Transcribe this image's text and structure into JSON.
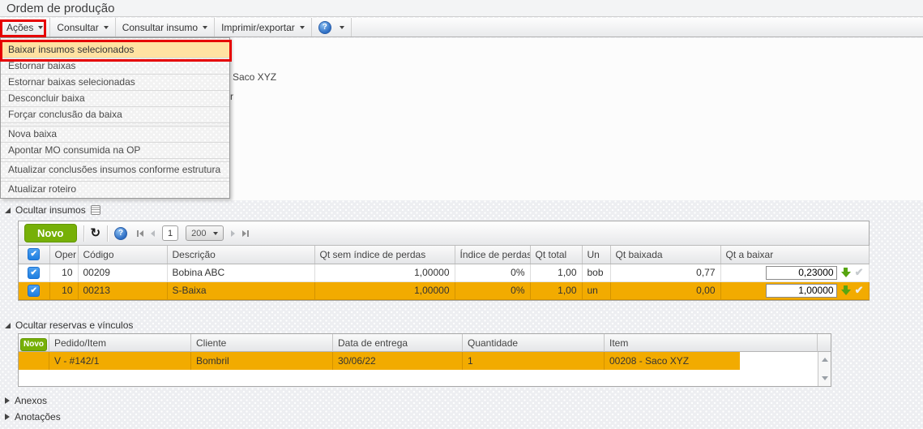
{
  "page": {
    "title": "Ordem de produção"
  },
  "toolbar": {
    "menus": [
      {
        "label": "Ações"
      },
      {
        "label": "Consultar"
      },
      {
        "label": "Consultar insumo"
      },
      {
        "label": "Imprimir/exportar"
      }
    ]
  },
  "icons": {
    "help": "?",
    "refresh": "↻",
    "check": "✔",
    "checkbox_check": "✔"
  },
  "context_menu": {
    "items": [
      "Baixar insumos selecionados",
      "Estornar baixas",
      "Estornar baixas selecionadas",
      "Desconcluir baixa",
      "Forçar conclusão da baixa",
      "Nova baixa",
      "Apontar MO consumida na OP",
      "Atualizar conclusões insumos conforme estrutura",
      "Atualizar roteiro"
    ],
    "highlighted_item": "Baixar insumos selecionados"
  },
  "background_fragments": {
    "item_text": "Saco XYZ",
    "partial_text": "r"
  },
  "sections": {
    "insumos": "Ocultar insumos",
    "reservas": "Ocultar reservas e vínculos",
    "anexos": "Anexos",
    "anotacoes": "Anotações"
  },
  "insumos_grid": {
    "new_button": "Novo",
    "page": "1",
    "page_size": "200",
    "columns": [
      "Oper",
      "Código",
      "Descrição",
      "Qt sem índice de perdas",
      "Índice de perdas",
      "Qt total",
      "Un",
      "Qt baixada",
      "Qt a baixar"
    ],
    "rows": [
      {
        "oper": "10",
        "codigo": "00209",
        "descricao": "Bobina ABC",
        "qt_sem_indice": "1,00000",
        "indice_perdas": "0%",
        "qt_total": "1,00",
        "un": "bob",
        "qt_baixada": "0,77",
        "qt_a_baixar": "0,23000"
      },
      {
        "oper": "10",
        "codigo": "00213",
        "descricao": "S-Baixa",
        "qt_sem_indice": "1,00000",
        "indice_perdas": "0%",
        "qt_total": "1,00",
        "un": "un",
        "qt_baixada": "0,00",
        "qt_a_baixar": "1,00000"
      }
    ]
  },
  "reservas_grid": {
    "new_button": "Novo",
    "columns": [
      "Pedido/Item",
      "Cliente",
      "Data de entrega",
      "Quantidade",
      "Item"
    ],
    "rows": [
      {
        "pedido_item": "V - #142/1",
        "cliente": "Bombril",
        "data_entrega": "30/06/22",
        "quantidade": "1",
        "item": "00208 - Saco XYZ"
      }
    ]
  },
  "colors": {
    "selection_orange": "#F2AB00",
    "menu_highlight": "#FFE2A2",
    "annotation_red": "#E60000",
    "novo_green": "#76B007",
    "checkbox_blue": "#2D8EE8",
    "download_green": "#57A510"
  }
}
